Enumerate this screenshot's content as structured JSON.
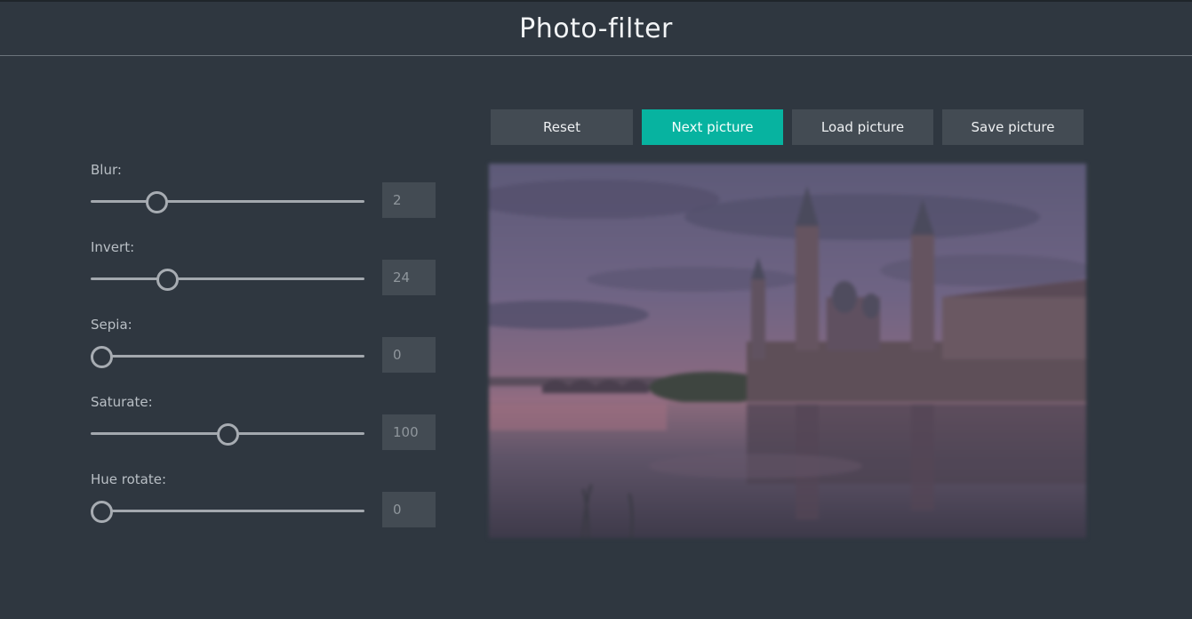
{
  "app": {
    "title": "Photo-filter"
  },
  "toolbar": {
    "reset_label": "Reset",
    "next_label": "Next picture",
    "load_label": "Load picture",
    "save_label": "Save picture"
  },
  "filters": [
    {
      "label": "Blur:",
      "value": "2",
      "fraction": 0.22
    },
    {
      "label": "Invert:",
      "value": "24",
      "fraction": 0.26
    },
    {
      "label": "Sepia:",
      "value": "0",
      "fraction": 0.0
    },
    {
      "label": "Saturate:",
      "value": "100",
      "fraction": 0.5
    },
    {
      "label": "Hue rotate:",
      "value": "0",
      "fraction": 0.0
    }
  ],
  "colors": {
    "background": "#2f3740",
    "accent": "#07b3a0",
    "button": "#434b53"
  }
}
